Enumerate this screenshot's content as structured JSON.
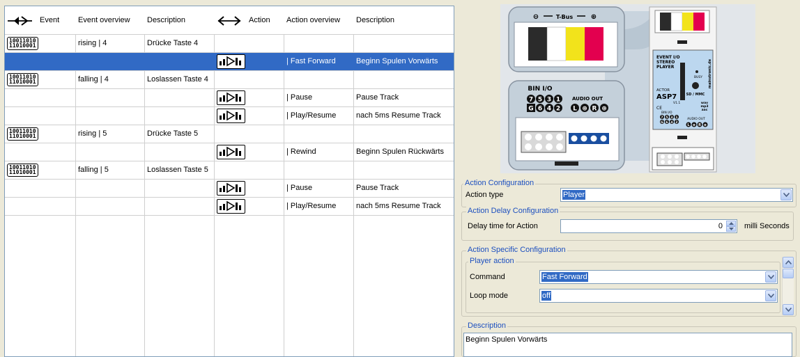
{
  "table": {
    "headers": {
      "event": "Event",
      "event_overview": "Event overview",
      "event_description": "Description",
      "action": "Action",
      "action_overview": "Action overview",
      "action_description": "Description"
    },
    "event_icon_text": [
      "10011010",
      "11010001"
    ],
    "rows": [
      {
        "kind": "event",
        "event_overview": "rising | 4",
        "event_description": "Drücke Taste 4",
        "action_overview": "",
        "action_description": "",
        "selected": false
      },
      {
        "kind": "action",
        "event_overview": "",
        "event_description": "",
        "action_overview": "| Fast Forward",
        "action_description": "Beginn Spulen Vorwärts",
        "selected": true
      },
      {
        "kind": "event",
        "event_overview": "falling | 4",
        "event_description": "Loslassen Taste 4",
        "action_overview": "",
        "action_description": "",
        "selected": false
      },
      {
        "kind": "action",
        "event_overview": "",
        "event_description": "",
        "action_overview": "| Pause",
        "action_description": "Pause Track",
        "selected": false
      },
      {
        "kind": "action",
        "event_overview": "",
        "event_description": "",
        "action_overview": "| Play/Resume",
        "action_description": "nach 5ms Resume Track",
        "selected": false
      },
      {
        "kind": "event",
        "event_overview": "rising | 5",
        "event_description": "Drücke Taste 5",
        "action_overview": "",
        "action_description": "",
        "selected": false
      },
      {
        "kind": "action",
        "event_overview": "",
        "event_description": "",
        "action_overview": "| Rewind",
        "action_description": "Beginn Spulen Rückwärts",
        "selected": false
      },
      {
        "kind": "event",
        "event_overview": "falling | 5",
        "event_description": "Loslassen Taste 5",
        "action_overview": "",
        "action_description": "",
        "selected": false
      },
      {
        "kind": "action",
        "event_overview": "",
        "event_description": "",
        "action_overview": "| Pause",
        "action_description": "Pause Track",
        "selected": false
      },
      {
        "kind": "action",
        "event_overview": "",
        "event_description": "",
        "action_overview": "| Play/Resume",
        "action_description": "nach 5ms Resume Track",
        "selected": false
      }
    ]
  },
  "device": {
    "tbus_label": "T-Bus",
    "tbus_minus": "⊖",
    "tbus_plus": "⊕",
    "bin_io_label": "BIN I/O",
    "bin_io_row1": [
      "7",
      "5",
      "3",
      "1"
    ],
    "bin_io_row2": [
      "G",
      "6",
      "4",
      "2"
    ],
    "audio_out_label": "AUDIO OUT",
    "audio_out_pins": [
      "L",
      "⊕",
      "R",
      "⊕"
    ],
    "module_title": [
      "EVENT I/O",
      "STEREO",
      "PLAYER"
    ],
    "module_actor": "ACTOR",
    "module_model": "ASP7",
    "module_version": "V1.1",
    "module_ce": "CE",
    "module_sd": "SD / MMC",
    "module_busy": "BUSY",
    "module_formats": [
      "wav",
      "mp3",
      "aac"
    ],
    "module_brand": "mainstronic.de",
    "module_bin_io": "BIN I/O",
    "module_bin_digits": [
      "7",
      "5",
      "3",
      "1",
      "G",
      "6",
      "4",
      "2"
    ],
    "module_audio_out": "AUDIO OUT",
    "module_audio_pins": [
      "L",
      "⊕",
      "R",
      "⊕"
    ],
    "colors": {
      "black": "#2b2b2b",
      "white": "#ffffff",
      "yellow": "#f2e31b",
      "red": "#e3004f",
      "module": "#bcd7ef",
      "device_bg": "#c6d3de",
      "terminal": "#1a4fa0"
    }
  },
  "action_config": {
    "title": "Action Configuration",
    "action_type_label": "Action type",
    "action_type_value": "Player"
  },
  "delay_config": {
    "title": "Action Delay Configuration",
    "delay_label": "Delay time for Action",
    "delay_value": "0",
    "delay_unit": "milli Seconds"
  },
  "specific_config": {
    "title": "Action Specific Configuration",
    "player_action_title": "Player action",
    "command_label": "Command",
    "command_value": "Fast Forward",
    "loop_label": "Loop mode",
    "loop_value": "off"
  },
  "description": {
    "title": "Description",
    "text": "Beginn Spulen Vorwärts"
  }
}
